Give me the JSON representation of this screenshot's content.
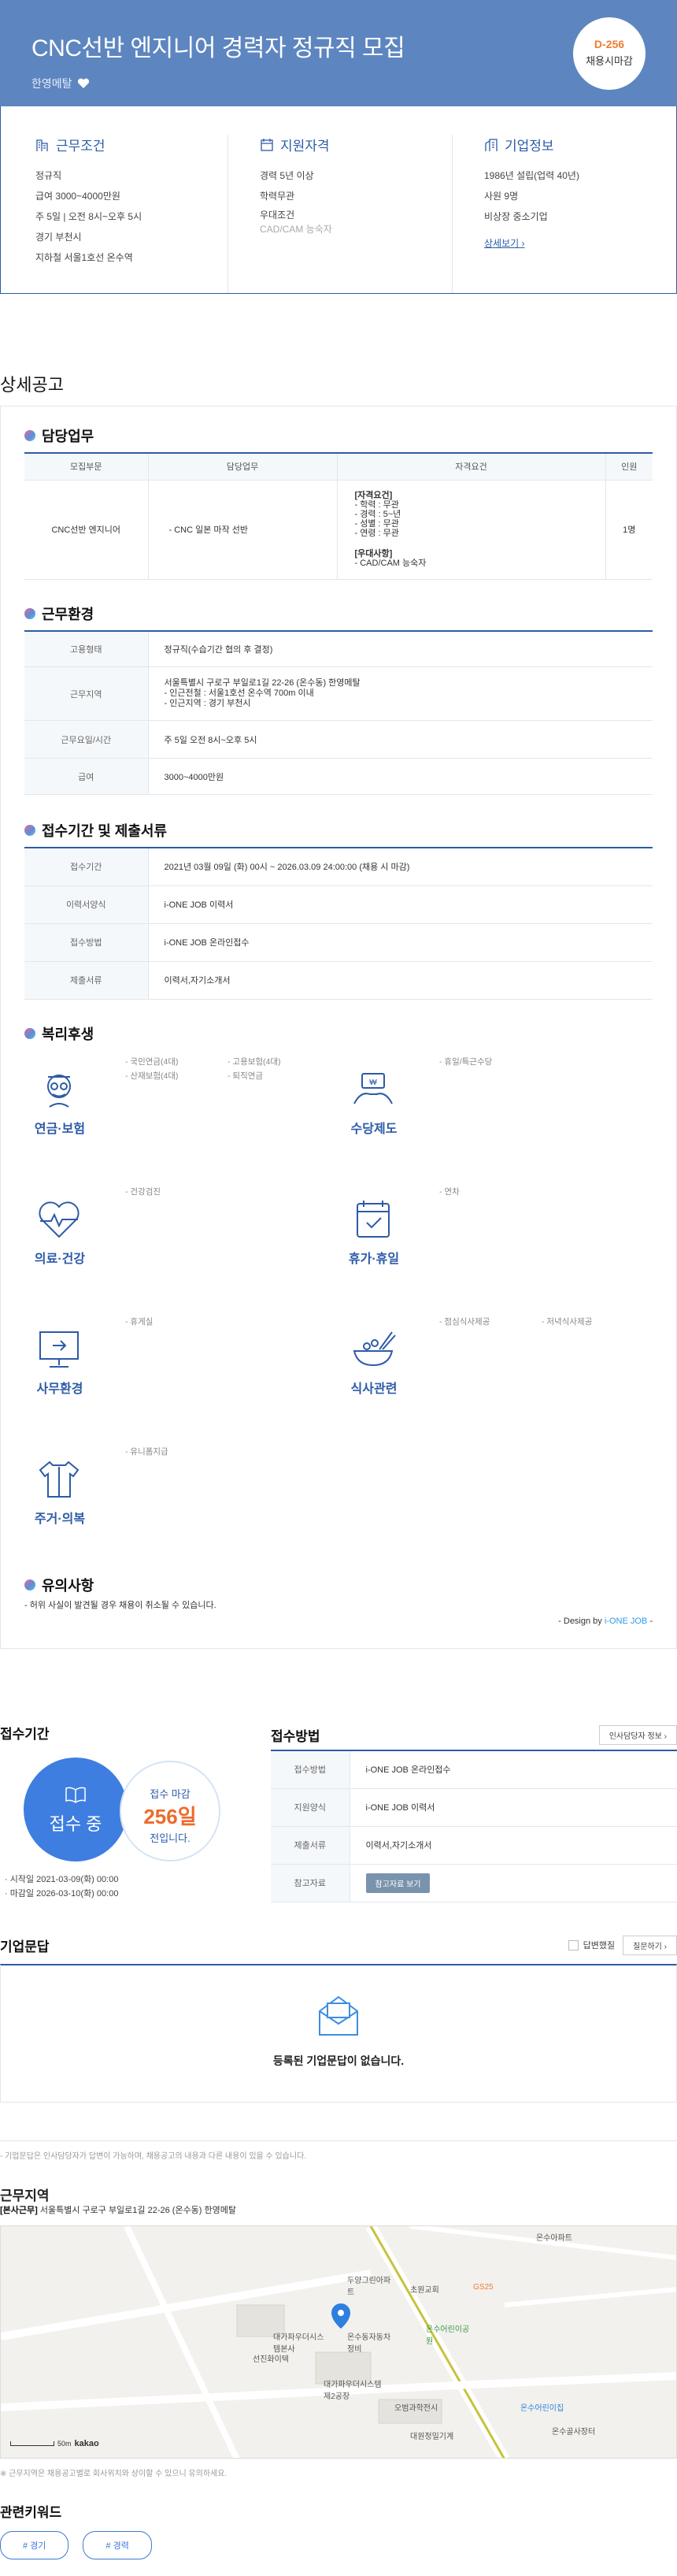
{
  "header": {
    "title": "CNC선반 엔지니어 경력자 정규직 모집",
    "company": "한영메탈",
    "dday": "D-256",
    "dday_label": "채용시마감"
  },
  "summary": {
    "work": {
      "title": "근무조건",
      "lines": [
        "정규직",
        "급여 3000~4000만원",
        "주 5일 | 오전 8시~오후 5시",
        "경기 부천시",
        "지하철 서울1호선 온수역"
      ]
    },
    "qual": {
      "title": "지원자격",
      "lines": [
        "경력 5년 이상",
        "학력무관",
        "우대조건"
      ],
      "sub": "CAD/CAM 능숙자"
    },
    "company": {
      "title": "기업정보",
      "lines": [
        "1986년 설립(업력 40년)",
        "사원 9명",
        "비상장 중소기업"
      ],
      "more": "상세보기 ›"
    }
  },
  "detail_title": "상세공고",
  "duty": {
    "title": "담당업무",
    "headers": [
      "모집부문",
      "담당업무",
      "자격요건",
      "인원"
    ],
    "row": {
      "part": "CNC선반 엔지니어",
      "task": "- CNC 일본 마작 선반",
      "req_head": "[자격요건]",
      "req": [
        "- 학력 : 무관",
        "- 경력 : 5~년",
        "- 성별 : 무관",
        "- 연령 : 무관"
      ],
      "pref_head": "[우대사항]",
      "pref": "- CAD/CAM 능숙자",
      "count": "1명"
    }
  },
  "env": {
    "title": "근무환경",
    "rows": [
      {
        "k": "고용형태",
        "v": "정규직(수습기간 협의 후 결정)"
      },
      {
        "k": "근무지역",
        "v": "서울특별시 구로구 부일로1길 22-26 (온수동) 한영메탈",
        "v2": "- 인근전철 : 서울1호선 온수역 700m 이내",
        "v3": "- 인근지역 : 경기 부천시"
      },
      {
        "k": "근무요일/시간",
        "v": "주 5일 오전 8시~오후 5시"
      },
      {
        "k": "급여",
        "v": "3000~4000만원"
      }
    ]
  },
  "apply": {
    "title": "접수기간 및 제출서류",
    "rows": [
      {
        "k": "접수기간",
        "v": "2021년 03월 09일 (화) 00시 ~ 2026.03.09 24:00:00 (채용 시 마감)"
      },
      {
        "k": "이력서양식",
        "v": "i-ONE JOB 이력서"
      },
      {
        "k": "접수방법",
        "v": "i-ONE JOB 온라인접수"
      },
      {
        "k": "제출서류",
        "v": "이력서,자기소개서"
      }
    ]
  },
  "welfare": {
    "title": "복리후생",
    "items": [
      {
        "name": "연금·보험",
        "icon": "pension-icon",
        "tags": [
          "- 국민연금(4대)",
          "- 고용보험(4대)",
          "- 산재보험(4대)",
          "- 퇴직연금"
        ]
      },
      {
        "name": "수당제도",
        "icon": "allowance-icon",
        "tags": [
          "- 휴일/특근수당"
        ]
      },
      {
        "name": "의료·건강",
        "icon": "health-icon",
        "tags": [
          "- 건강검진"
        ]
      },
      {
        "name": "휴가·휴일",
        "icon": "vacation-icon",
        "tags": [
          "- 연차"
        ]
      },
      {
        "name": "사무환경",
        "icon": "office-icon",
        "tags": [
          "- 휴게실"
        ]
      },
      {
        "name": "식사관련",
        "icon": "meal-icon",
        "tags": [
          "- 점심식사제공",
          "- 저녁식사제공"
        ]
      },
      {
        "name": "주거·의복",
        "icon": "clothing-icon",
        "tags": [
          "- 유니폼지급"
        ]
      }
    ]
  },
  "notice": {
    "title": "유의사항",
    "text": "- 허위 사실이 발견될 경우 채용이 취소될 수 있습니다.",
    "design_prefix": "- Design by ",
    "design_brand": "i-ONE JOB",
    "design_suffix": " -"
  },
  "period": {
    "title": "접수기간",
    "status": "접수 중",
    "deadline_label": "접수 마감",
    "days": "256일",
    "days_suffix": "전입니다.",
    "start": "· 시작일 2021-03-09(화) 00:00",
    "end": "· 마감일 2026-03-10(화) 00:00"
  },
  "method": {
    "title": "접수방법",
    "hr_btn": "인사담당자 정보 ›",
    "rows": [
      {
        "k": "접수방법",
        "v": "i-ONE JOB 온라인접수"
      },
      {
        "k": "지원양식",
        "v": "i-ONE JOB 이력서"
      },
      {
        "k": "제출서류",
        "v": "이력서,자기소개서"
      },
      {
        "k": "참고자료",
        "btn": "참고자료 보기"
      }
    ]
  },
  "qa": {
    "title": "기업문답",
    "answered": "답변했질",
    "ask": "질문하기 ›",
    "empty": "등록된 기업문답이 없습니다.",
    "note": "- 기업문답은 인사담당자가 답변이 가능하며, 채용공고의 내용과 다른 내용이 있을 수 있습니다."
  },
  "location": {
    "title": "근무지역",
    "addr_label": "[본사근무]",
    "addr": " 서울특별시 구로구 부일로1길 22-26 (온수동) 한영메탈",
    "note": "※ 근무지역은 채용공고별로 회사위치와 상이할 수 있으니 유의하세요.",
    "scale": "50m",
    "kakao": "kakao",
    "places": [
      "온수아파트",
      "두양그린아파트",
      "초원교회",
      "GS25",
      "대가파우더시스템본사",
      "온수동자동차정비",
      "온수어린이공원",
      "선진화이텍",
      "대가파우더시스템제2공장",
      "오범과학전시",
      "온수어린이집",
      "대원정밀기계",
      "온수골사장터"
    ]
  },
  "keywords": {
    "title": "관련키워드",
    "items": [
      "# 경기",
      "# 경력"
    ]
  }
}
